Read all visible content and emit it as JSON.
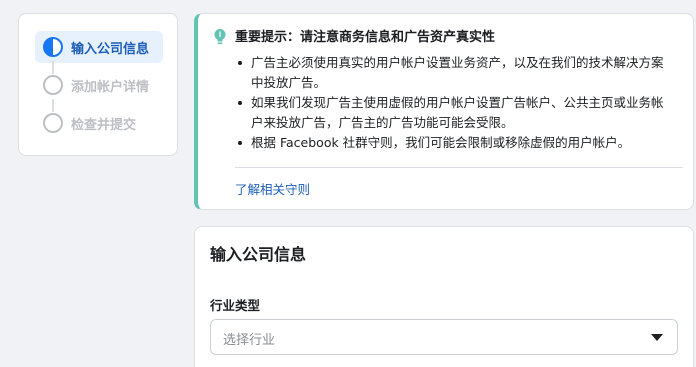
{
  "stepper": {
    "steps": [
      {
        "label": "输入公司信息",
        "state": "active"
      },
      {
        "label": "添加帐户详情",
        "state": "pending"
      },
      {
        "label": "检查并提交",
        "state": "pending"
      }
    ]
  },
  "notice": {
    "icon": "lightbulb-icon",
    "title": "重要提示：请注意商务信息和广告资产真实性",
    "bullets": [
      "广告主必须使用真实的用户帐户设置业务资产，以及在我们的技术解决方案中投放广告。",
      "如果我们发现广告主使用虚假的用户帐户设置广告帐户、公共主页或业务帐户来投放广告，广告主的广告功能可能会受限。",
      "根据 Facebook 社群守则，我们可能会限制或移除虚假的用户帐户。"
    ],
    "link_label": "了解相关守则"
  },
  "form": {
    "heading": "输入公司信息",
    "industry_label": "行业类型",
    "industry_placeholder": "选择行业"
  },
  "colors": {
    "accent": "#1877f2",
    "link": "#1d5fb8",
    "notice_border": "#63c3b4",
    "background": "#f0f2f5"
  }
}
